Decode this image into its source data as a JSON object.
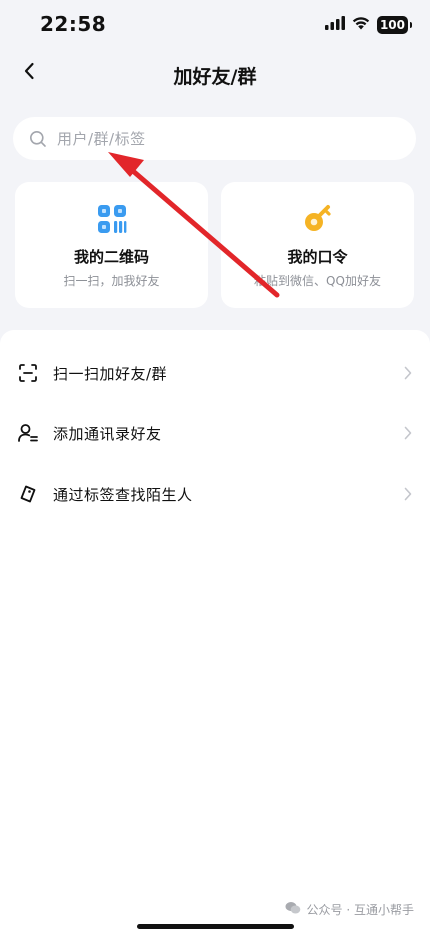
{
  "status_bar": {
    "time": "22:58",
    "battery": "100",
    "icons": [
      "signal-icon",
      "wifi-icon",
      "battery-icon"
    ]
  },
  "nav": {
    "title": "加好友/群",
    "back_icon": "chevron-left-icon"
  },
  "search": {
    "placeholder": "用户/群/标签",
    "icon": "search-icon"
  },
  "cards": [
    {
      "title": "我的二维码",
      "subtitle": "扫一扫，加我好友",
      "icon": "qr-code-icon",
      "color": "#3a9bf0"
    },
    {
      "title": "我的口令",
      "subtitle": "粘贴到微信、QQ加好友",
      "icon": "key-icon",
      "color": "#f5b324"
    }
  ],
  "list": [
    {
      "label": "扫一扫加好友/群",
      "icon": "scan-icon"
    },
    {
      "label": "添加通讯录好友",
      "icon": "contacts-icon"
    },
    {
      "label": "通过标签查找陌生人",
      "icon": "tag-icon"
    }
  ],
  "watermark": {
    "text": "公众号 · 互通小帮手",
    "icon": "wechat-icon"
  },
  "colors": {
    "background": "#f3f4f8",
    "annotation_arrow": "#e2262a",
    "secondary_text": "#8d9097"
  }
}
